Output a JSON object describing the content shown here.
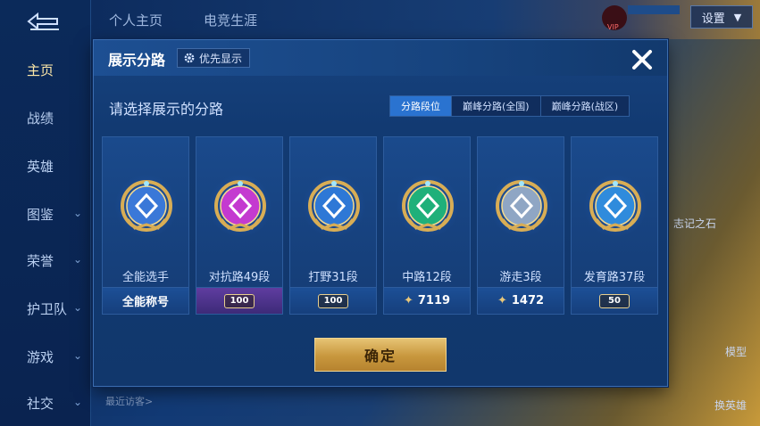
{
  "sidebar": {
    "items": [
      {
        "label": "主页",
        "active": true,
        "chevron": false
      },
      {
        "label": "战绩",
        "active": false,
        "chevron": false
      },
      {
        "label": "英雄",
        "active": false,
        "chevron": false
      },
      {
        "label": "图鉴",
        "active": false,
        "chevron": true
      },
      {
        "label": "荣誉",
        "active": false,
        "chevron": true
      },
      {
        "label": "护卫队",
        "active": false,
        "chevron": true
      },
      {
        "label": "游戏",
        "active": false,
        "chevron": true
      },
      {
        "label": "社交",
        "active": false,
        "chevron": true
      }
    ]
  },
  "topbar": {
    "tabs": [
      "个人主页",
      "电竞生涯"
    ],
    "settings_label": "设置",
    "vip_label": "VIP"
  },
  "background": {
    "visitors_label": "最近访客>",
    "right_labels": [
      "志记之石",
      "模型",
      "换英雄"
    ]
  },
  "modal": {
    "title": "展示分路",
    "priority_label": "优先显示",
    "subtitle": "请选择展示的分路",
    "segment_tabs": [
      {
        "label": "分路段位",
        "active": true
      },
      {
        "label": "巅峰分路(全国)",
        "active": false
      },
      {
        "label": "巅峰分路(战区)",
        "active": false
      }
    ],
    "cards": [
      {
        "label": "全能选手",
        "badge_text": "全能称号",
        "badge_style": "plain",
        "emblem": "all-round-emblem-icon",
        "color": "#3a78d8"
      },
      {
        "label": "对抗路49段",
        "badge_text": "100",
        "badge_style": "purple",
        "emblem": "clash-lane-emblem-icon",
        "color": "#c43ad0"
      },
      {
        "label": "打野31段",
        "badge_text": "100",
        "badge_style": "pill",
        "emblem": "jungle-emblem-icon",
        "color": "#2e78d6"
      },
      {
        "label": "中路12段",
        "badge_text": "7119",
        "badge_style": "star",
        "emblem": "mid-lane-emblem-icon",
        "color": "#1fb07a"
      },
      {
        "label": "游走3段",
        "badge_text": "1472",
        "badge_style": "star",
        "emblem": "roam-emblem-icon",
        "color": "#8fa6c4"
      },
      {
        "label": "发育路37段",
        "badge_text": "50",
        "badge_style": "pill",
        "emblem": "farm-lane-emblem-icon",
        "color": "#2f8bdc"
      }
    ],
    "confirm_label": "确定"
  },
  "colors": {
    "accent": "#2a73d0",
    "gold": "#d8ad55",
    "panel": "#123a72"
  }
}
